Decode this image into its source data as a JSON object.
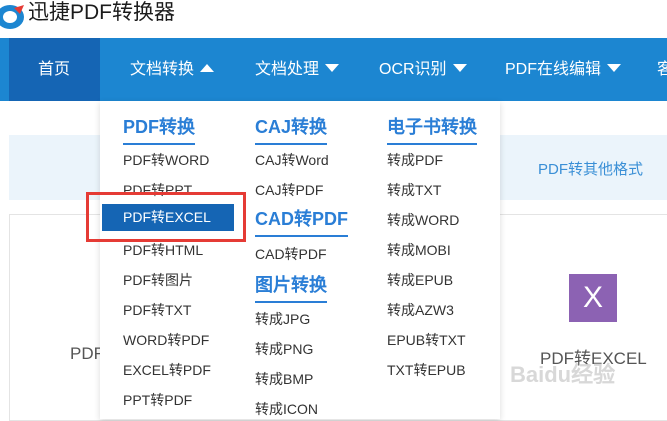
{
  "app": {
    "title": "迅捷PDF转换器"
  },
  "nav": {
    "items": [
      {
        "label": "首页"
      },
      {
        "label": "文档转换"
      },
      {
        "label": "文档处理"
      },
      {
        "label": "OCR识别"
      },
      {
        "label": "PDF在线编辑"
      },
      {
        "label": "客"
      }
    ]
  },
  "dropdown": {
    "columns": [
      {
        "heading": "PDF转换",
        "items": [
          "PDF转WORD",
          "PDF转PPT",
          "PDF转EXCEL",
          "PDF转HTML",
          "PDF转图片",
          "PDF转TXT",
          "WORD转PDF",
          "EXCEL转PDF",
          "PPT转PDF"
        ]
      },
      {
        "heading": "CAJ转换",
        "items": [
          "CAJ转Word",
          "CAJ转PDF"
        ]
      },
      {
        "heading": "CAD转PDF",
        "items": [
          "CAD转PDF"
        ]
      },
      {
        "heading": "图片转换",
        "items": [
          "转成JPG",
          "转成PNG",
          "转成BMP",
          "转成ICON"
        ]
      },
      {
        "heading": "电子书转换",
        "items": [
          "转成PDF",
          "转成TXT",
          "转成WORD",
          "转成MOBI",
          "转成EPUB",
          "转成AZW3",
          "EPUB转TXT",
          "TXT转EPUB"
        ]
      }
    ],
    "selected": "PDF转EXCEL"
  },
  "background": {
    "band_text": "PDF转其他格式",
    "card_icon_letter": "X",
    "card_label": "PDF转EXCEL",
    "card_label_left": "PDF",
    "watermark": "Baidu经验"
  }
}
